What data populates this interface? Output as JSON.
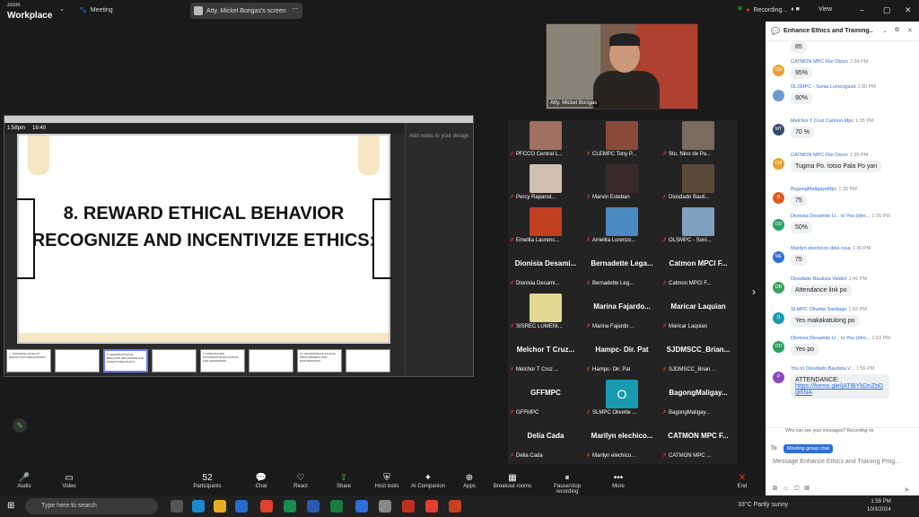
{
  "app": {
    "brand_small": "zoom",
    "brand_big": "Workplace",
    "meeting": "Meeting",
    "screen_pill": "Atty. Mickel Borigas's screen",
    "recording": "Recording...",
    "view": "View"
  },
  "share": {
    "clock": "1:58pm",
    "duration": "19:40",
    "slide_title": "8. REWARD ETHICAL BEHAVIOR RECOGNIZE AND INCENTIVIZE ETHICS:",
    "notes_placeholder": "Add notes to your design",
    "thumbs": [
      "7. ORGANIZE CONFLICT RESOLUTION MECHANISMS",
      "",
      "8. REWARD ETHICAL BEHAVIOR RECOGNIZE AND INCENTIVIZE ETHICS",
      "",
      "9. STRENGTHEN COOPERATIVE EDUCATION AND AWARENESS",
      "",
      "10. INCORPORATE ETHICAL PROCUREMENT AND PARTNERSHIPS",
      "",
      ""
    ]
  },
  "speaker": {
    "name": "Atty. Mickel Borigas"
  },
  "gallery": [
    {
      "big": "",
      "label": "PFCCO Central L...",
      "color": "#a07060"
    },
    {
      "big": "",
      "label": "CLEMPC Tony P...",
      "color": "#8a4a3a"
    },
    {
      "big": "",
      "label": "Sto. Nino de Pa...",
      "color": "#7a6a60"
    },
    {
      "big": "",
      "label": "Percy Rapanut...",
      "color": "#d0c0b0"
    },
    {
      "big": "",
      "label": "Marvin Esteban",
      "color": "#3a2a2a"
    },
    {
      "big": "",
      "label": "Diosdado Bauti...",
      "color": "#5a4a3a"
    },
    {
      "big": "",
      "label": "Emelita Laurenc...",
      "color": "#c04020"
    },
    {
      "big": "",
      "label": "Amelita Lorenzo...",
      "color": "#4a8ac0"
    },
    {
      "big": "",
      "label": "OLSMPC - Soni...",
      "color": "#80a0c0"
    },
    {
      "big": "Dionisia Desami...",
      "label": "Dionisia Desami...",
      "color": ""
    },
    {
      "big": "Bernadette Lega...",
      "label": "Bernadette Leg...",
      "color": ""
    },
    {
      "big": "Catmon MPCI F...",
      "label": "Catmon MPCI F...",
      "color": ""
    },
    {
      "big": "",
      "label": "SISREC LUMENI...",
      "color": "#e0d890"
    },
    {
      "big": "Marina Fajardo...",
      "label": "Marina Fajardo ...",
      "color": ""
    },
    {
      "big": "Maricar Laquian",
      "label": "Maricar Laquian",
      "color": ""
    },
    {
      "big": "Melchor T Cruz...",
      "label": "Melchor T Cruz ...",
      "color": ""
    },
    {
      "big": "Hampc- Dir. Pat",
      "label": "Hampc- Dir. Pat",
      "color": ""
    },
    {
      "big": "SJDMSCC_Brian...",
      "label": "SJDMSCC_Brian ...",
      "color": ""
    },
    {
      "big": "GFFMPC",
      "label": "GFFMPC",
      "color": ""
    },
    {
      "big": "O",
      "label": "SLMPC Olivette ...",
      "color": "#1a9ab0"
    },
    {
      "big": "BagongMaligay...",
      "label": "BagongMaligay...",
      "color": ""
    },
    {
      "big": "Delia Cada",
      "label": "Delia Cada",
      "color": ""
    },
    {
      "big": "Marilyn elechico...",
      "label": "Marilyn elechico...",
      "color": ""
    },
    {
      "big": "CATMON MPC F...",
      "label": "CATMON MPC ...",
      "color": ""
    }
  ],
  "chat": {
    "title": "Enhance Ethics and Training...",
    "messages": [
      {
        "init": "",
        "color": "",
        "sender": "",
        "time": "",
        "text": "85",
        "link": ""
      },
      {
        "init": "CM",
        "color": "#e8a030",
        "sender": "CATMON MPC Flor Dizon",
        "time": "1:34 PM",
        "text": "95%",
        "link": ""
      },
      {
        "init": "",
        "color": "#6a9ad0",
        "sender": "OLSMPC - Sonia Lumongsod",
        "time": "1:35 PM",
        "text": "90%",
        "link": ""
      },
      {
        "init": "MT",
        "color": "#3a4a6a",
        "sender": "Melchor T Cruz  Catmon Mpc",
        "time": "1:35 PM",
        "text": "70 %",
        "link": ""
      },
      {
        "init": "CM",
        "color": "#e8a030",
        "sender": "CATMON MPC Flor Dizon",
        "time": "1:35 PM",
        "text": "Tugma Po. totoo Pala Po yan",
        "link": ""
      },
      {
        "init": "B",
        "color": "#e05a20",
        "sender": "BagongMaligayaMpc",
        "time": "1:35 PM",
        "text": "75",
        "link": ""
      },
      {
        "init": "DD",
        "color": "#2aa060",
        "sender": "Dionisia Desamito U... to You (dire...",
        "time": "1:35 PM",
        "text": "50%",
        "link": ""
      },
      {
        "init": "ME",
        "color": "#2d6ed8",
        "sender": "Marilyn elechicon dela rosa",
        "time": "1:36 PM",
        "text": "75",
        "link": ""
      },
      {
        "init": "DB",
        "color": "#3aa060",
        "sender": "Diosdado Bautista Valdez",
        "time": "1:41 PM",
        "text": "Attendance link po",
        "link": ""
      },
      {
        "init": "O",
        "color": "#1a9ab0",
        "sender": "SLMPC Olivette Santiago",
        "time": "1:52 PM",
        "text": "Yes makakatulong po",
        "link": ""
      },
      {
        "init": "DD",
        "color": "#2aa060",
        "sender": "Dionisia Desamito U... to You (dire...",
        "time": "1:53 PM",
        "text": "Yes po",
        "link": ""
      },
      {
        "init": "P",
        "color": "#8a4ac0",
        "sender": "You to Diosdado Bautista V...",
        "time": "1:56 PM",
        "text": "ATTENDANCE:",
        "link": "https://forms.gle/jATiBYkDnZbDqi6NA"
      }
    ],
    "who_can_see": "Who can see your messages? Recording on",
    "to_label": "To:",
    "to_pill": "Meeting group chat",
    "placeholder": "Message Enhance Ethics and Training Prog..."
  },
  "toolbar": [
    {
      "icon": "🎤",
      "label": "Audio"
    },
    {
      "icon": "▭",
      "label": "Video"
    },
    {
      "icon": "52",
      "label": "Participants"
    },
    {
      "icon": "💬",
      "label": "Chat"
    },
    {
      "icon": "♡",
      "label": "React"
    },
    {
      "icon": "⇪",
      "label": "Share"
    },
    {
      "icon": "⛨",
      "label": "Host tools"
    },
    {
      "icon": "✦",
      "label": "AI Companion"
    },
    {
      "icon": "⊕",
      "label": "Apps"
    },
    {
      "icon": "▦",
      "label": "Breakout rooms"
    },
    {
      "icon": "⏸",
      "label": "Pause/stop recording"
    },
    {
      "icon": "•••",
      "label": "More"
    },
    {
      "icon": "✕",
      "label": "End"
    }
  ],
  "taskbar": {
    "search": "Type here to search",
    "weather": "33°C  Partly sunny",
    "time": "1:59 PM",
    "date": "10/3/2024"
  }
}
